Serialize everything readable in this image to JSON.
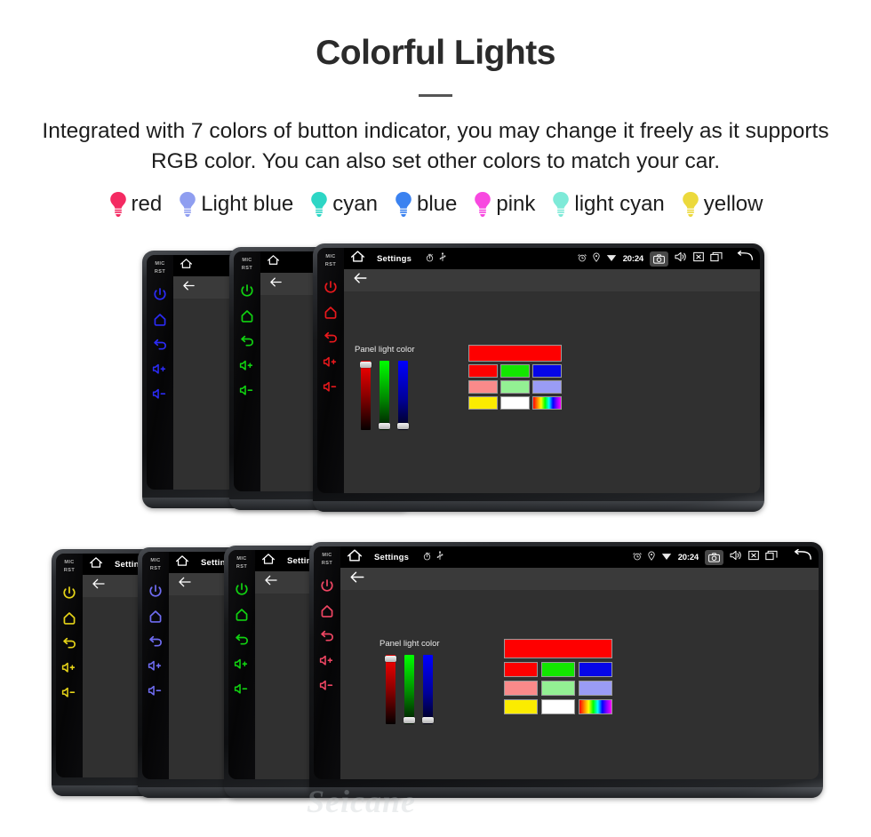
{
  "header": {
    "title": "Colorful Lights",
    "description": "Integrated with 7 colors of button indicator, you may change it freely as it supports RGB color. You can also set other colors to match your car."
  },
  "legend": {
    "items": [
      {
        "label": "red",
        "color": "#f42a62"
      },
      {
        "label": "Light blue",
        "color": "#8f9ef0"
      },
      {
        "label": "cyan",
        "color": "#2dd6c5"
      },
      {
        "label": "blue",
        "color": "#3b82f0"
      },
      {
        "label": "pink",
        "color": "#f848e0"
      },
      {
        "label": "light cyan",
        "color": "#7eead8"
      },
      {
        "label": "yellow",
        "color": "#ecd93c"
      }
    ]
  },
  "device_ui": {
    "hw_labels": {
      "mic": "MIC",
      "rst": "RST"
    },
    "hw_buttons": [
      "power-icon",
      "home-icon",
      "back-icon",
      "volume-up-icon",
      "volume-down-icon"
    ],
    "statusbar": {
      "title": "Settings",
      "time": "20:24",
      "left_icons": [
        "home-icon",
        "timer-icon",
        "usb-icon"
      ],
      "right_icons": [
        "alarm-icon",
        "location-icon",
        "wifi-icon",
        "camera-icon",
        "volume-icon",
        "close-icon",
        "recents-icon",
        "back-icon"
      ]
    },
    "actionbar": {
      "back": "back-arrow-icon"
    },
    "panel": {
      "title": "Panel light color",
      "sliders": [
        {
          "name": "red",
          "thumb": "top"
        },
        {
          "name": "green",
          "thumb": "bottom"
        },
        {
          "name": "blue",
          "thumb": "bottom"
        }
      ],
      "preview_color": "#fe0000",
      "swatch_rows": [
        [
          "#fe0000",
          "#13e600",
          "#0606e8"
        ],
        [
          "#fa8a8a",
          "#93f093",
          "#9a9cf5"
        ],
        [
          "#fbec00",
          "#ffffff",
          "rainbow"
        ]
      ]
    }
  },
  "row1": {
    "devices": [
      {
        "accent": "#2b2bf5",
        "role": "stacked"
      },
      {
        "accent": "#11d211",
        "role": "stacked"
      },
      {
        "accent": "#e8181c",
        "role": "front"
      }
    ]
  },
  "row2": {
    "devices": [
      {
        "accent": "#e5d318",
        "role": "stacked"
      },
      {
        "accent": "#6f6cf2",
        "role": "stacked"
      },
      {
        "accent": "#11d211",
        "role": "stacked"
      },
      {
        "accent": "#ef4663",
        "role": "front"
      }
    ]
  },
  "watermark": {
    "text": "Seicane"
  }
}
